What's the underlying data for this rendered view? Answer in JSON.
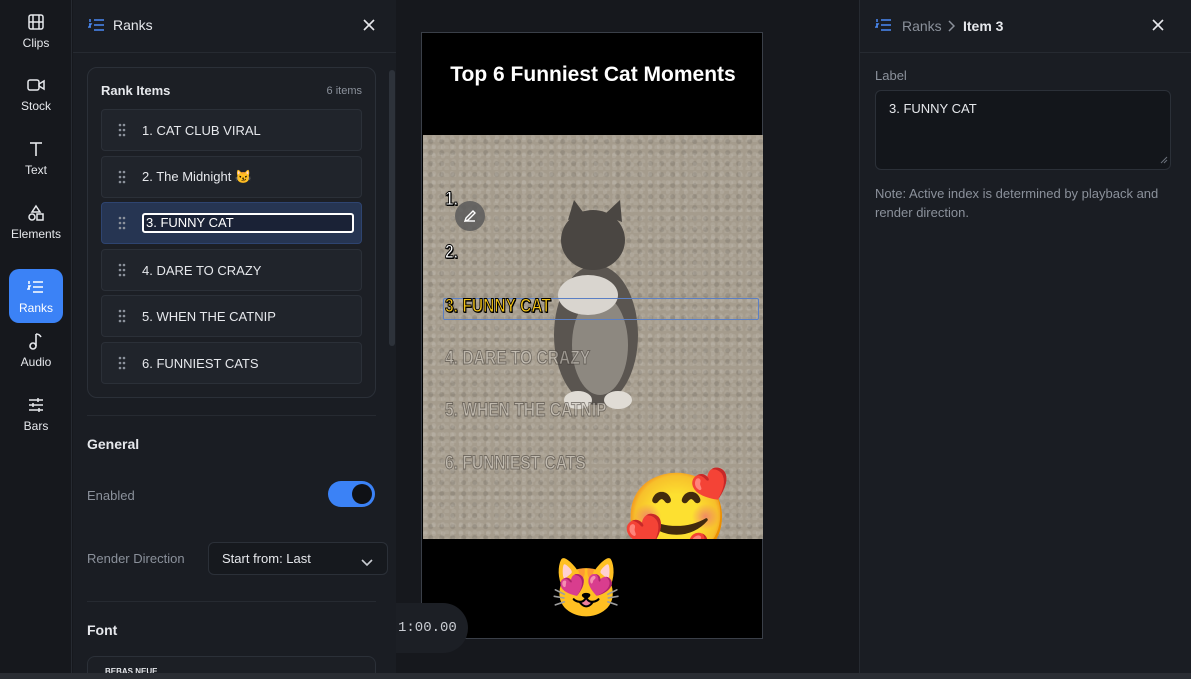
{
  "rail": {
    "items": [
      {
        "label": "Clips",
        "icon": "film-icon"
      },
      {
        "label": "Stock",
        "icon": "video-camera-icon"
      },
      {
        "label": "Text",
        "icon": "text-icon"
      },
      {
        "label": "Elements",
        "icon": "shapes-icon"
      },
      {
        "label": "Ranks",
        "icon": "ranked-list-icon",
        "active": true
      },
      {
        "label": "Audio",
        "icon": "music-note-icon"
      },
      {
        "label": "Bars",
        "icon": "sliders-icon"
      }
    ]
  },
  "ranks_panel": {
    "title": "Ranks",
    "card_title": "Rank Items",
    "count_label": "6 items",
    "items": [
      {
        "label": "1. CAT CLUB VIRAL"
      },
      {
        "label": "2. The Midnight 😼"
      },
      {
        "label": "3. FUNNY CAT",
        "selected": true,
        "editing": true
      },
      {
        "label": "4. DARE TO CRAZY"
      },
      {
        "label": "5. WHEN THE CATNIP"
      },
      {
        "label": "6. FUNNIEST CATS"
      }
    ],
    "general_title": "General",
    "enabled_label": "Enabled",
    "enabled": true,
    "render_direction_label": "Render Direction",
    "render_direction_value": "Start from: Last",
    "font_title": "Font",
    "font_value": "BEBAS NEUE"
  },
  "preview": {
    "title": "Top 6 Funniest Cat Moments",
    "rank_lines": [
      {
        "text": "1."
      },
      {
        "text": "2."
      },
      {
        "text": "3. FUNNY CAT",
        "state": "active"
      },
      {
        "text": "4. DARE TO CRAZY",
        "state": "faded"
      },
      {
        "text": "5. WHEN THE CATNIP",
        "state": "faded"
      },
      {
        "text": "6. FUNNIEST CATS",
        "state": "faded"
      }
    ],
    "sticker_emoji_1": "🥰",
    "sticker_emoji_2": "😻",
    "timecode": "1:00.00"
  },
  "inspector": {
    "breadcrumb_root": "Ranks",
    "breadcrumb_current": "Item 3",
    "label_title": "Label",
    "label_value": "3. FUNNY CAT",
    "note": "Note: Active index is determined by playback and render direction."
  },
  "colors": {
    "accent": "#3b82f6",
    "active_rank_text": "#f5c518"
  }
}
